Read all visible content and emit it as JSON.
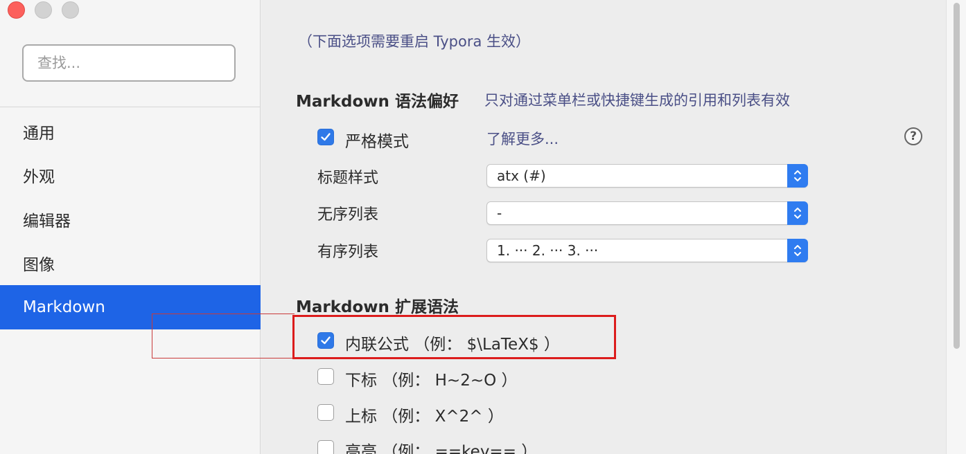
{
  "window": {
    "traffic_lights": [
      "close",
      "minimize",
      "zoom"
    ]
  },
  "sidebar": {
    "search_placeholder": "查找...",
    "items": [
      {
        "label": "通用",
        "active": false
      },
      {
        "label": "外观",
        "active": false
      },
      {
        "label": "编辑器",
        "active": false
      },
      {
        "label": "图像",
        "active": false
      },
      {
        "label": "Markdown",
        "active": true
      }
    ]
  },
  "main": {
    "restart_note": "（下面选项需要重启 Typora 生效）",
    "syntax_pref": {
      "title": "Markdown 语法偏好",
      "hint": "只对通过菜单栏或快捷键生成的引用和列表有效",
      "strict_mode": {
        "label": "严格模式",
        "checked": true
      },
      "learn_more": "了解更多...",
      "help_icon": "?",
      "heading_style": {
        "label": "标题样式",
        "value": "atx (#)"
      },
      "unordered_list": {
        "label": "无序列表",
        "value": "-"
      },
      "ordered_list": {
        "label": "有序列表",
        "value": "1. ··· 2. ··· 3. ···"
      }
    },
    "extended_syntax": {
      "title": "Markdown 扩展语法",
      "options": [
        {
          "label": "内联公式 （例： $\\LaTeX$ ）",
          "checked": true
        },
        {
          "label": "下标 （例： H~2~O ）",
          "checked": false
        },
        {
          "label": "上标 （例： X^2^ ）",
          "checked": false
        },
        {
          "label": "高亮 （例： ==key== ）",
          "checked": false
        }
      ]
    }
  },
  "colors": {
    "accent": "#1e64e6",
    "annotation": "#dc1c1c",
    "hint_text": "#4a4f86"
  }
}
